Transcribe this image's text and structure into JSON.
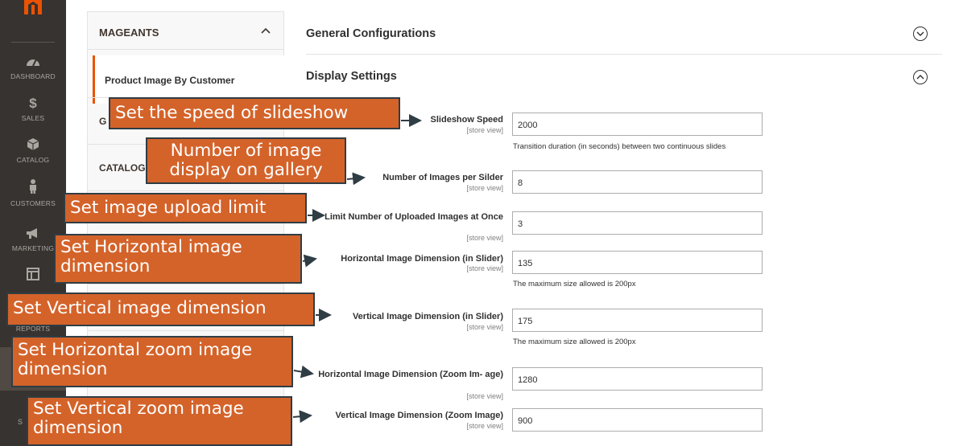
{
  "admin_nav": {
    "items": [
      {
        "icon": "dashboard-gauge-icon",
        "label": "DASHBOARD"
      },
      {
        "icon": "dollar-icon",
        "label": "SALES"
      },
      {
        "icon": "cube-icon",
        "label": "CATALOG"
      },
      {
        "icon": "person-icon",
        "label": "CUSTOMERS"
      },
      {
        "icon": "megaphone-icon",
        "label": "MARKETING"
      },
      {
        "icon": "layout-icon",
        "label": ""
      },
      {
        "icon": "bar-chart-icon",
        "label": "REPORTS"
      }
    ],
    "stores_partial": "S"
  },
  "tabs": {
    "group_title": "MAGEANTS",
    "active_item": "Product Image By Customer",
    "rows": [
      "G",
      "CATALOG"
    ]
  },
  "sections": {
    "general": "General Configurations",
    "display": "Display Settings"
  },
  "fields": [
    {
      "label": "Slideshow Speed",
      "scope": "[store view]",
      "value": "2000",
      "note": "Transition duration (in seconds) between two continuous slides"
    },
    {
      "label": "Number of Images per Silder",
      "scope": "[store view]",
      "value": "8",
      "note": ""
    },
    {
      "label": "Limit Number of Uploaded Images at Once",
      "scope": "[store view]",
      "value": "3",
      "note": ""
    },
    {
      "label": "Horizontal Image Dimension (in Slider)",
      "scope": "[store view]",
      "value": "135",
      "note": "The maximum size allowed is 200px"
    },
    {
      "label": "Vertical Image Dimension (in Slider)",
      "scope": "[store view]",
      "value": "175",
      "note": "The maximum size allowed is 200px"
    },
    {
      "label": "Horizontal Image Dimension (Zoom Im- age)",
      "scope": "[store view]",
      "value": "1280",
      "note": ""
    },
    {
      "label": "Vertical Image Dimension (Zoom Image)",
      "scope": "[store view]",
      "value": "900",
      "note": ""
    }
  ],
  "callouts": [
    "Set the speed of slideshow",
    "Number of image display on gallery",
    "Set image upload limit",
    "Set Horizontal image dimension",
    "Set Vertical image dimension",
    "Set Horizontal zoom image dimension",
    "Set Vertical zoom image dimension"
  ],
  "colors": {
    "sidebar": "#373330",
    "accent": "#eb5202",
    "callout_fill": "#d4632a",
    "callout_border": "#2f3d45"
  }
}
